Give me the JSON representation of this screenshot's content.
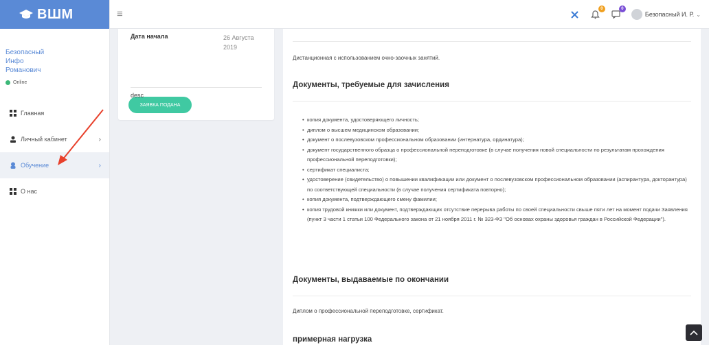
{
  "brand": {
    "name": "ВШМ"
  },
  "user": {
    "name_lines": [
      "Безопасный",
      "Инфо",
      "Романович"
    ],
    "status": "Online"
  },
  "nav": [
    {
      "label": "Главная",
      "icon": "dashboard-icon"
    },
    {
      "label": "Личный кабинет",
      "icon": "user-icon"
    },
    {
      "label": "Обучение",
      "icon": "education-icon"
    },
    {
      "label": "О нас",
      "icon": "dashboard-icon"
    }
  ],
  "topbar": {
    "profile_name": "Безопасный И. Р.",
    "bell_count": "0",
    "msg_count": "0"
  },
  "course": {
    "start_label": "Дата начала",
    "start_value_line1": "26 Августа",
    "start_value_line2": "2019",
    "apply_button": "ЗАЯВКА ПОДАНА",
    "desc": "desc"
  },
  "main": {
    "form_text": "Дистанционная с использованием очно-заочных занятий.",
    "docs_required_title": "Документы, требуемые для зачисления",
    "docs_required": [
      "копия документа, удостоверяющего личность;",
      "диплом о высшем медицинском образовании;",
      "документ о послевузовском профессиональном образовании (интернатура, ординатура);",
      "документ государственного образца о профессиональной переподготовке (в случае получения новой специальности по результатам прохождения профессиональной переподготовки);",
      "сертификат специалиста;",
      "удостоверение (свидетельство) о повышении квалификации или документ о послевузовском профессиональном образовании (аспирантура, докторантура) по соответствующей специальности (в случае получения сертификата повторно);",
      "копия документа, подтверждающего смену фамилии;",
      "копия трудовой книжки или документ, подтверждающих отсутствие перерыва работы по своей специальности свыше пяти лет на момент подачи Заявления (пункт 3 части 1 статьи 100 Федерального закона от 21 ноября 2011 г. № 323-ФЗ \"Об основах охраны здоровья граждан в Российской Федерации\")."
    ],
    "docs_issued_title": "Документы, выдаваемые по окончании",
    "docs_issued_text": "Диплом о профессиональной переподготовке, сертификат.",
    "load_title": "примерная нагрузка"
  },
  "colors": {
    "brand": "#5a8ad6",
    "online": "#3cb878",
    "button": "#40c9a2",
    "arrow": "#e8412c",
    "badge_orange": "#f0a020",
    "badge_purple": "#7a4fd6"
  }
}
